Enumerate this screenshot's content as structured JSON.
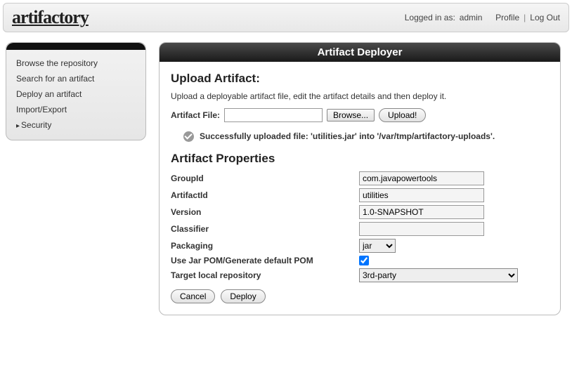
{
  "header": {
    "logo": "artifactory",
    "logged_in_prefix": "Logged in as:",
    "user": "admin",
    "profile": "Profile",
    "logout": "Log Out"
  },
  "sidebar": {
    "items": [
      {
        "label": "Browse the repository",
        "active": false
      },
      {
        "label": "Search for an artifact",
        "active": false
      },
      {
        "label": "Deploy an artifact",
        "active": false
      },
      {
        "label": "Import/Export",
        "active": false
      },
      {
        "label": "Security",
        "active": true
      }
    ]
  },
  "panel": {
    "title": "Artifact Deployer",
    "upload": {
      "heading": "Upload Artifact:",
      "description": "Upload a deployable artifact file, edit the artifact details and then deploy it.",
      "file_label": "Artifact File:",
      "file_value": "",
      "browse_label": "Browse...",
      "upload_label": "Upload!"
    },
    "status": {
      "text": "Successfully uploaded file: 'utilities.jar' into '/var/tmp/artifactory-uploads'."
    },
    "properties": {
      "heading": "Artifact Properties",
      "groupId": {
        "label": "GroupId",
        "value": "com.javapowertools"
      },
      "artifactId": {
        "label": "ArtifactId",
        "value": "utilities"
      },
      "version": {
        "label": "Version",
        "value": "1.0-SNAPSHOT"
      },
      "classifier": {
        "label": "Classifier",
        "value": ""
      },
      "packaging": {
        "label": "Packaging",
        "value": "jar"
      },
      "usePom": {
        "label": "Use Jar POM/Generate default POM",
        "checked": true
      },
      "targetRepo": {
        "label": "Target local repository",
        "value": "3rd-party"
      }
    },
    "actions": {
      "cancel": "Cancel",
      "deploy": "Deploy"
    }
  }
}
